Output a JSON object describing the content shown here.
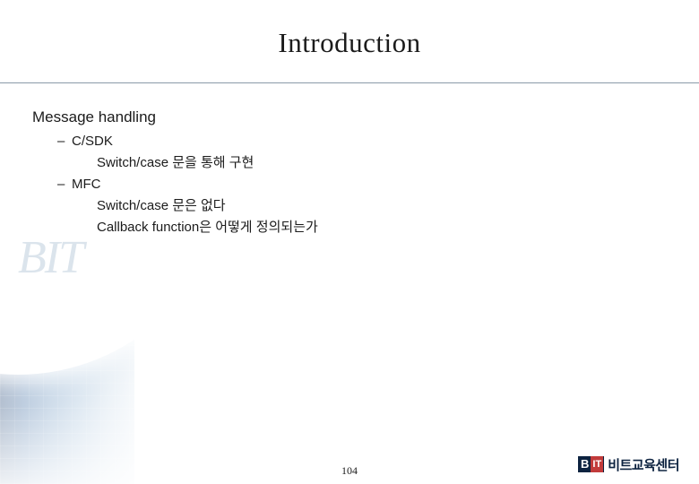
{
  "slide": {
    "title": "Introduction",
    "page_number": "104"
  },
  "content": {
    "heading": "Message handling",
    "sections": [
      {
        "bullet": "–",
        "label": "C/SDK",
        "lines": [
          "Switch/case 문을 통해 구현"
        ]
      },
      {
        "bullet": "–",
        "label": "MFC",
        "lines": [
          "Switch/case 문은 없다",
          "Callback function은 어떻게 정의되는가"
        ]
      }
    ]
  },
  "footer": {
    "logo_b": "B",
    "logo_it": "IT",
    "logo_text": "비트교육센터"
  },
  "decor": {
    "ghost_text": "BIT"
  },
  "colors": {
    "title_text": "#1b1b1b",
    "rule": "#8a9aa8",
    "logo_navy": "#0d2340",
    "logo_red": "#c23b3b"
  }
}
